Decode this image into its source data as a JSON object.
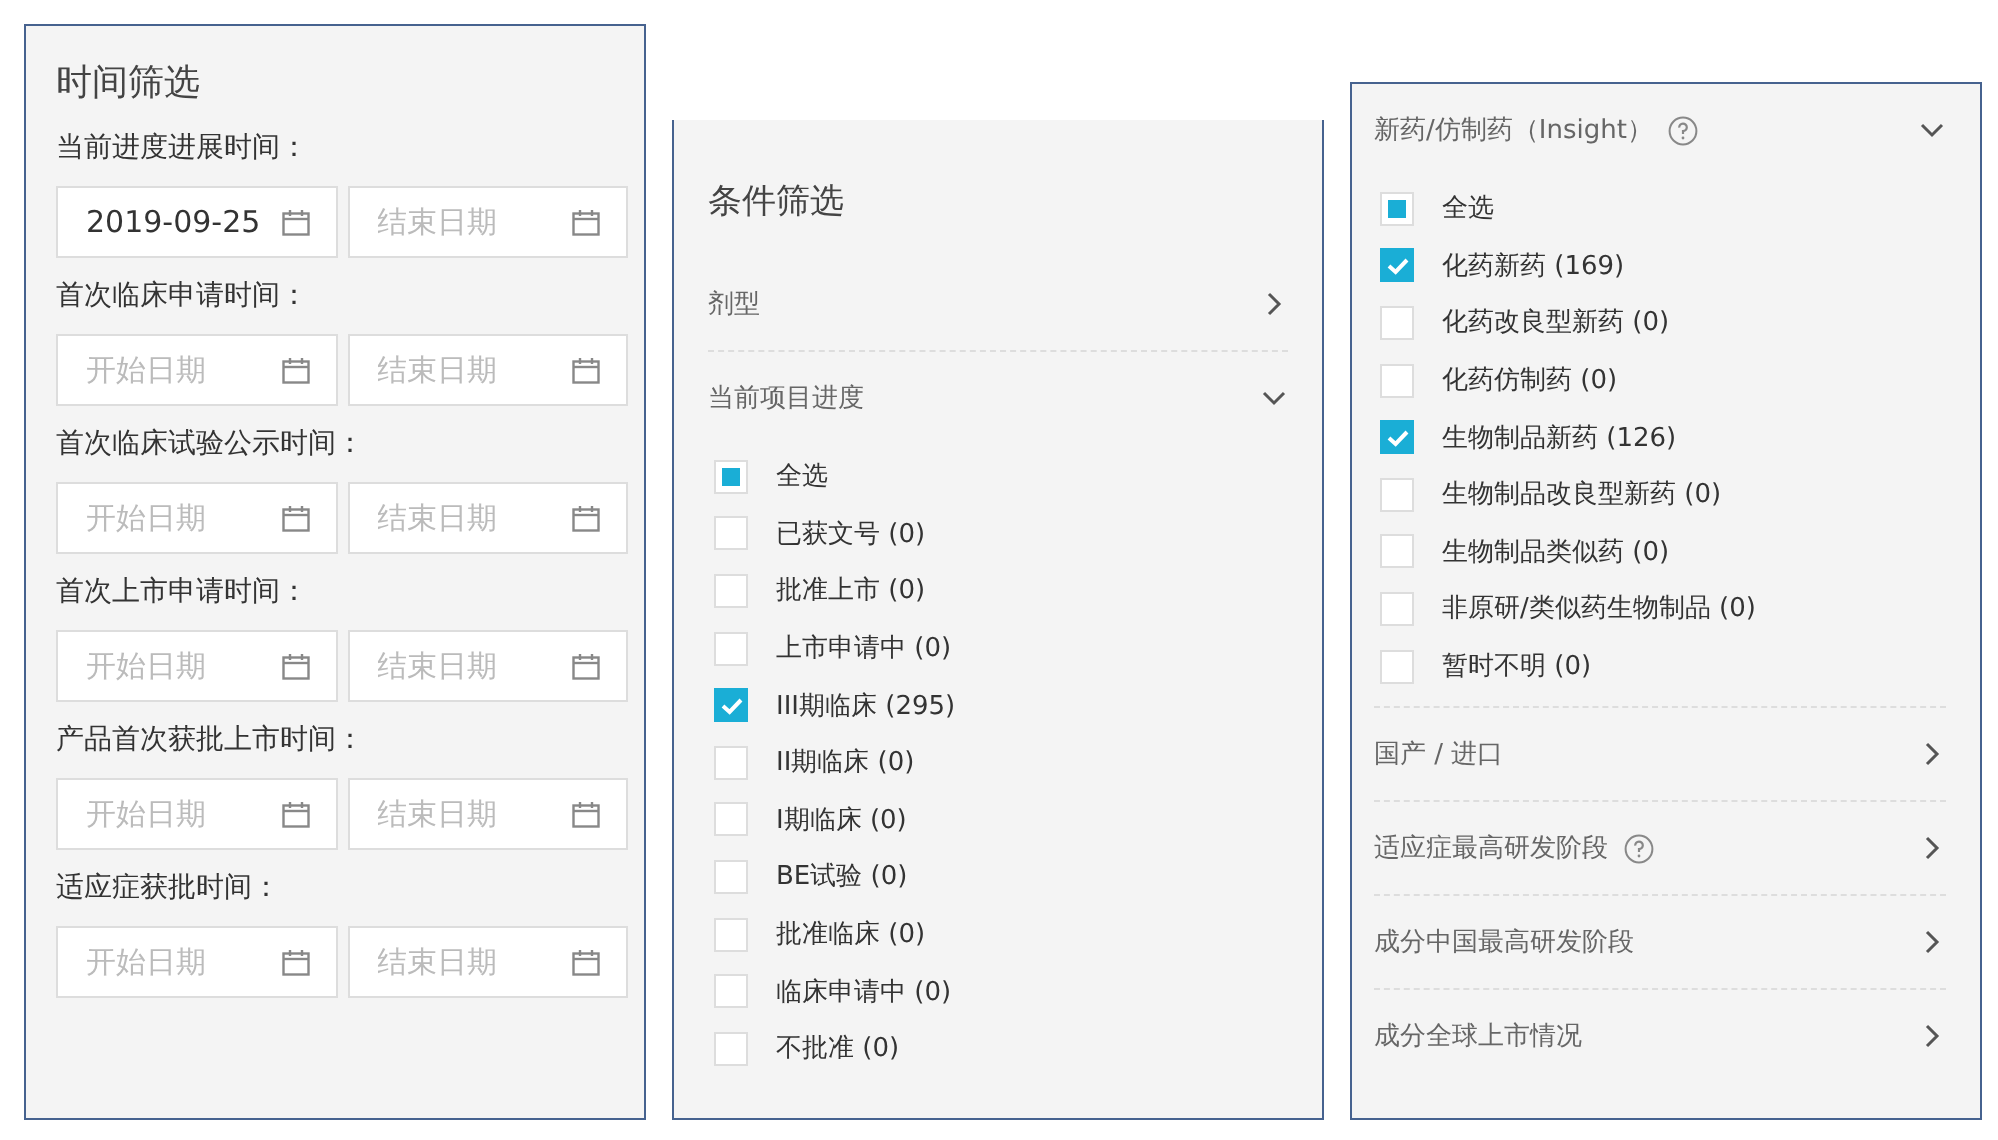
{
  "time_filter": {
    "title": "时间筛选",
    "groups": [
      {
        "label": "当前进度进展时间：",
        "start": {
          "value": "2019-09-25"
        },
        "end": {
          "placeholder": "结束日期"
        }
      },
      {
        "label": "首次临床申请时间：",
        "start": {
          "placeholder": "开始日期"
        },
        "end": {
          "placeholder": "结束日期"
        }
      },
      {
        "label": "首次临床试验公示时间：",
        "start": {
          "placeholder": "开始日期"
        },
        "end": {
          "placeholder": "结束日期"
        }
      },
      {
        "label": "首次上市申请时间：",
        "start": {
          "placeholder": "开始日期"
        },
        "end": {
          "placeholder": "结束日期"
        }
      },
      {
        "label": "产品首次获批上市时间：",
        "start": {
          "placeholder": "开始日期"
        },
        "end": {
          "placeholder": "结束日期"
        }
      },
      {
        "label": "适应症获批时间：",
        "start": {
          "placeholder": "开始日期"
        },
        "end": {
          "placeholder": "结束日期"
        }
      }
    ]
  },
  "condition_filter": {
    "title": "条件筛选",
    "sections": [
      {
        "label": "剂型",
        "help": false,
        "expanded": false
      },
      {
        "label": "当前项目进度",
        "help": false,
        "expanded": true,
        "options": [
          {
            "label": "全选",
            "checked": false,
            "indeterminate": true
          },
          {
            "label": "已获文号 (0)",
            "checked": false,
            "indeterminate": false
          },
          {
            "label": "批准上市 (0)",
            "checked": false,
            "indeterminate": false
          },
          {
            "label": "上市申请中 (0)",
            "checked": false,
            "indeterminate": false
          },
          {
            "label": "III期临床 (295)",
            "checked": true,
            "indeterminate": false
          },
          {
            "label": "II期临床 (0)",
            "checked": false,
            "indeterminate": false
          },
          {
            "label": "I期临床 (0)",
            "checked": false,
            "indeterminate": false
          },
          {
            "label": "BE试验 (0)",
            "checked": false,
            "indeterminate": false
          },
          {
            "label": "批准临床 (0)",
            "checked": false,
            "indeterminate": false
          },
          {
            "label": "临床申请中 (0)",
            "checked": false,
            "indeterminate": false
          },
          {
            "label": "不批准 (0)",
            "checked": false,
            "indeterminate": false
          }
        ]
      }
    ]
  },
  "drug_filter": {
    "sections": [
      {
        "label": "新药/仿制药（Insight）",
        "help": true,
        "expanded": true,
        "options": [
          {
            "label": "全选",
            "checked": false,
            "indeterminate": true
          },
          {
            "label": "化药新药 (169)",
            "checked": true,
            "indeterminate": false
          },
          {
            "label": "化药改良型新药 (0)",
            "checked": false,
            "indeterminate": false
          },
          {
            "label": "化药仿制药 (0)",
            "checked": false,
            "indeterminate": false
          },
          {
            "label": "生物制品新药 (126)",
            "checked": true,
            "indeterminate": false
          },
          {
            "label": "生物制品改良型新药 (0)",
            "checked": false,
            "indeterminate": false
          },
          {
            "label": "生物制品类似药 (0)",
            "checked": false,
            "indeterminate": false
          },
          {
            "label": "非原研/类似药生物制品 (0)",
            "checked": false,
            "indeterminate": false
          },
          {
            "label": "暂时不明 (0)",
            "checked": false,
            "indeterminate": false
          }
        ]
      },
      {
        "label": "国产 / 进口",
        "help": false,
        "expanded": false
      },
      {
        "label": "适应症最高研发阶段",
        "help": true,
        "expanded": false
      },
      {
        "label": "成分中国最高研发阶段",
        "help": false,
        "expanded": false
      },
      {
        "label": "成分全球上市情况",
        "help": false,
        "expanded": false
      }
    ]
  }
}
